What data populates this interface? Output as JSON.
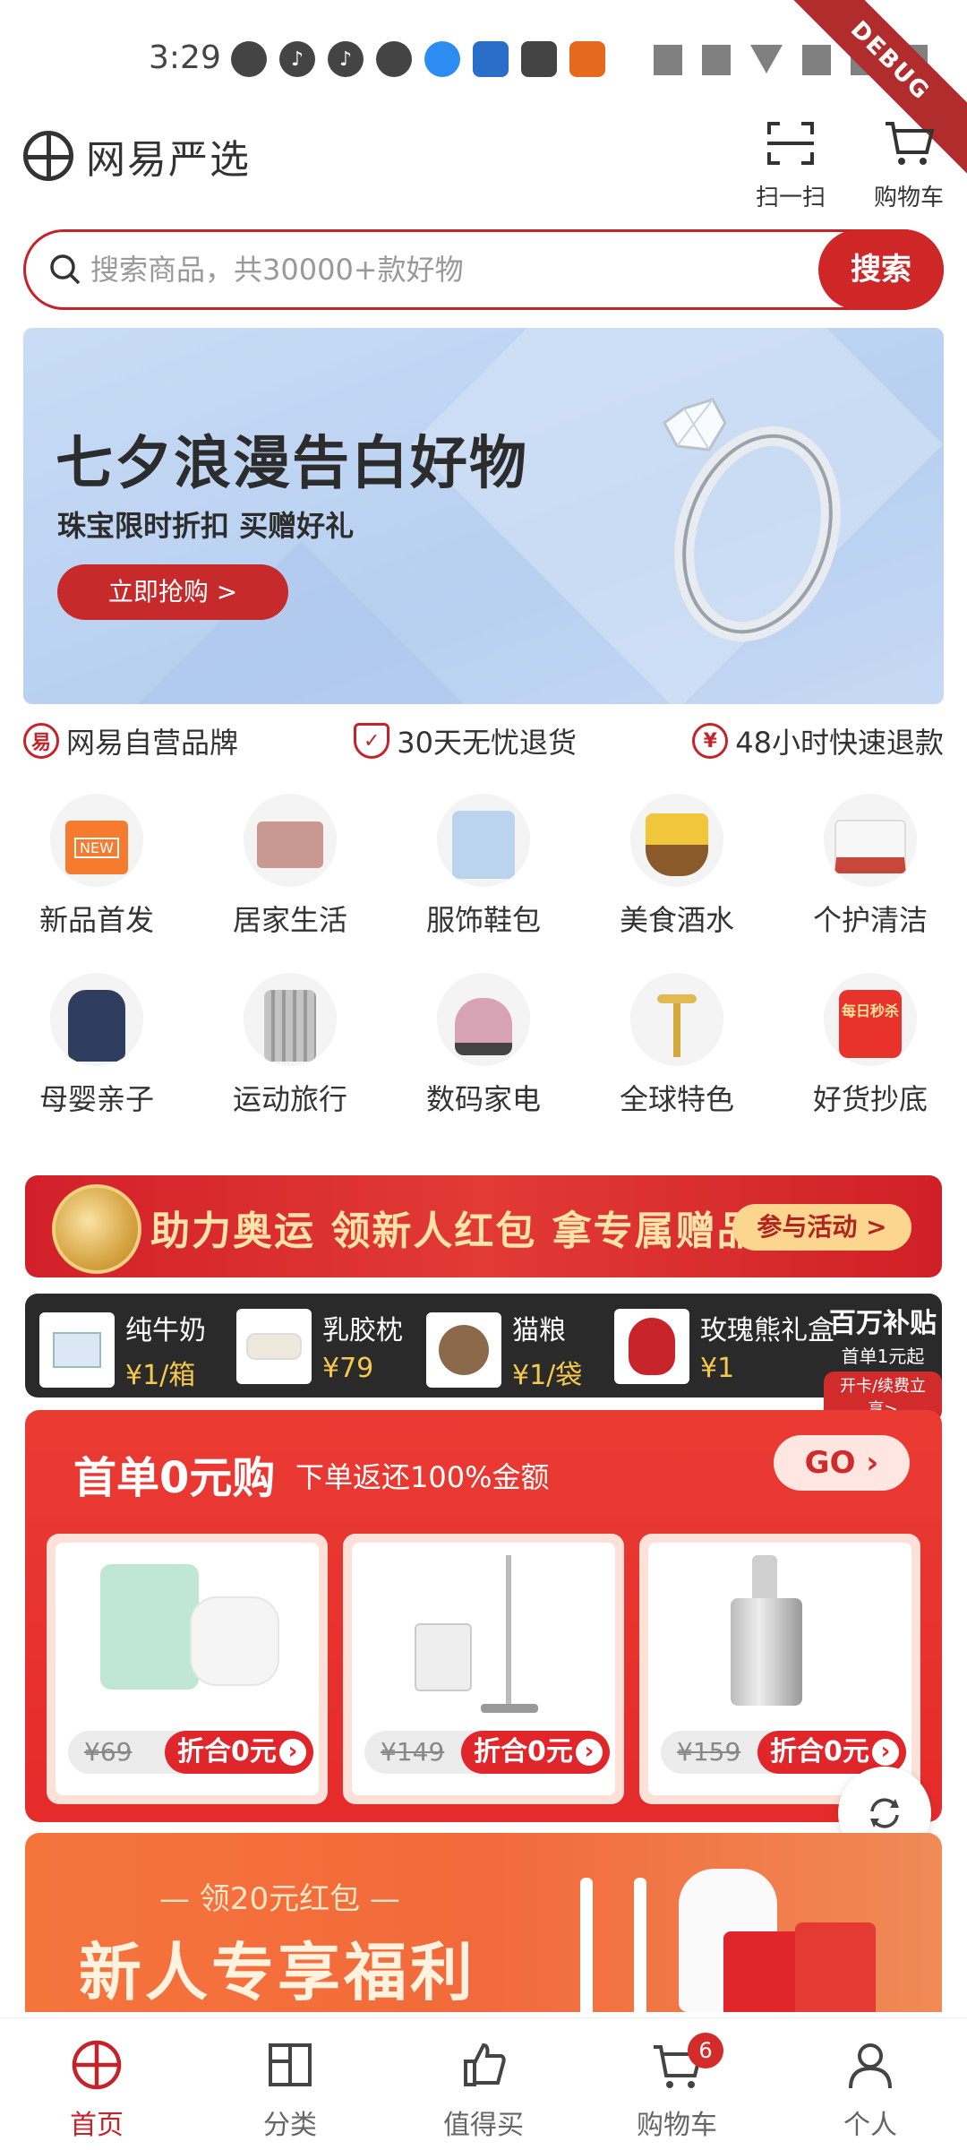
{
  "status_bar": {
    "time": "3:29",
    "debug_label": "DEBUG"
  },
  "header": {
    "logo_text": "网易严选",
    "scan_label": "扫一扫",
    "cart_label": "购物车"
  },
  "search": {
    "placeholder": "搜索商品，共30000+款好物",
    "button_label": "搜索"
  },
  "banner": {
    "title": "七夕浪漫告白好物",
    "subtitle": "珠宝限时折扣  买赠好礼",
    "cta": "立即抢购 >"
  },
  "promises": [
    {
      "icon": "yanxuan-icon",
      "text": "网易自营品牌"
    },
    {
      "icon": "shield-icon",
      "text": "30天无忧退货"
    },
    {
      "icon": "yen-icon",
      "text": "48小时快速退款"
    }
  ],
  "categories": [
    {
      "label": "新品首发",
      "icon": "new-bag-icon"
    },
    {
      "label": "居家生活",
      "icon": "bed-icon"
    },
    {
      "label": "服饰鞋包",
      "icon": "shirt-icon"
    },
    {
      "label": "美食酒水",
      "icon": "noodle-icon"
    },
    {
      "label": "个护清洁",
      "icon": "tissue-icon"
    },
    {
      "label": "母婴亲子",
      "icon": "backpack-icon"
    },
    {
      "label": "运动旅行",
      "icon": "suitcase-icon"
    },
    {
      "label": "数码家电",
      "icon": "vacuum-icon"
    },
    {
      "label": "全球特色",
      "icon": "roller-icon"
    },
    {
      "label": "好货抄底",
      "icon": "daily-sale-icon"
    }
  ],
  "category_badges": {
    "new": "NEW",
    "daily_sale": "每日秒杀"
  },
  "olympic": {
    "text": "助力奥运 领新人红包 拿专属赠品",
    "button": "参与活动 >"
  },
  "subsidy": {
    "deals": [
      {
        "name": "纯牛奶",
        "price": "¥1/箱"
      },
      {
        "name": "乳胶枕",
        "price": "¥79"
      },
      {
        "name": "猫粮",
        "price": "¥1/袋"
      },
      {
        "name": "玫瑰熊礼盒",
        "price": "¥1"
      }
    ],
    "title": "百万补贴",
    "subtitle": "首单1元起",
    "tag": "开卡/续费立享>"
  },
  "first_order": {
    "title": "首单0元购",
    "subtitle": "下单返还100%金额",
    "go": "GO",
    "items": [
      {
        "old_price": "¥69",
        "deal": "折合0元"
      },
      {
        "old_price": "¥149",
        "deal": "折合0元"
      },
      {
        "old_price": "¥159",
        "deal": "折合0元"
      }
    ]
  },
  "newcomer": {
    "line1": "— 领20元红包 —",
    "line2": "新人专享福利"
  },
  "tabbar": [
    {
      "label": "首页",
      "icon": "home-icon",
      "active": true
    },
    {
      "label": "分类",
      "icon": "category-icon"
    },
    {
      "label": "值得买",
      "icon": "thumbs-up-icon"
    },
    {
      "label": "购物车",
      "icon": "cart-icon",
      "badge": "6"
    },
    {
      "label": "个人",
      "icon": "person-icon"
    }
  ],
  "colors": {
    "brand_red": "#c4232a",
    "banner_blue": "#b7cff0",
    "gold": "#f5c94b"
  }
}
